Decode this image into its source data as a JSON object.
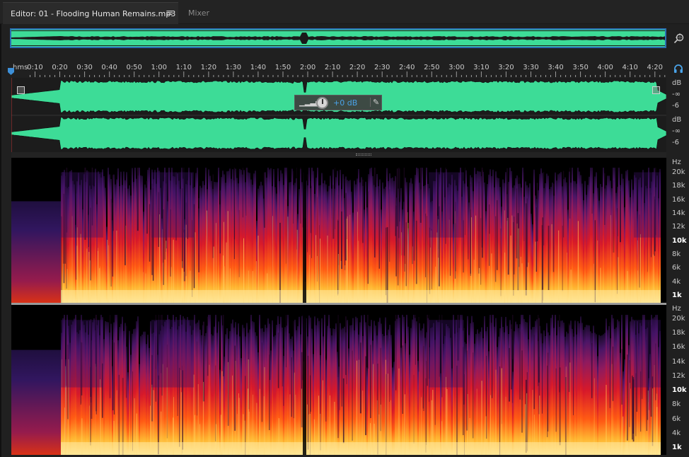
{
  "tabs": {
    "editor": {
      "label": "Editor: 01 - Flooding Human Remains.mp3",
      "menu_icon": "hamburger-menu-icon"
    },
    "mixer": {
      "label": "Mixer"
    }
  },
  "icons": {
    "zoom": "zoom-magnifier-icon",
    "headphones": "headphones-icon",
    "pin": "pin-icon"
  },
  "ruler": {
    "unit": "hms",
    "labels": [
      "0:10",
      "0:20",
      "0:30",
      "0:40",
      "0:50",
      "1:00",
      "1:10",
      "1:20",
      "1:30",
      "1:40",
      "1:50",
      "2:00",
      "2:10",
      "2:20",
      "2:30",
      "2:40",
      "2:50",
      "3:00",
      "3:10",
      "3:20",
      "3:30",
      "3:40",
      "3:50",
      "4:00",
      "4:10",
      "4:20"
    ]
  },
  "hud": {
    "gain": "+0 dB"
  },
  "db_scale": {
    "unit": "dB",
    "minus_inf": "-∞",
    "minus6": "-6"
  },
  "hz_scale": {
    "unit": "Hz",
    "labels": [
      "20k",
      "18k",
      "16k",
      "14k",
      "12k",
      "10k",
      "8k",
      "6k",
      "4k",
      "1k"
    ],
    "bold": [
      "10k",
      "1k"
    ]
  },
  "colors": {
    "waveform": "#3ddc97",
    "accent": "#3d8fd8",
    "background": "#1d1d1d"
  }
}
